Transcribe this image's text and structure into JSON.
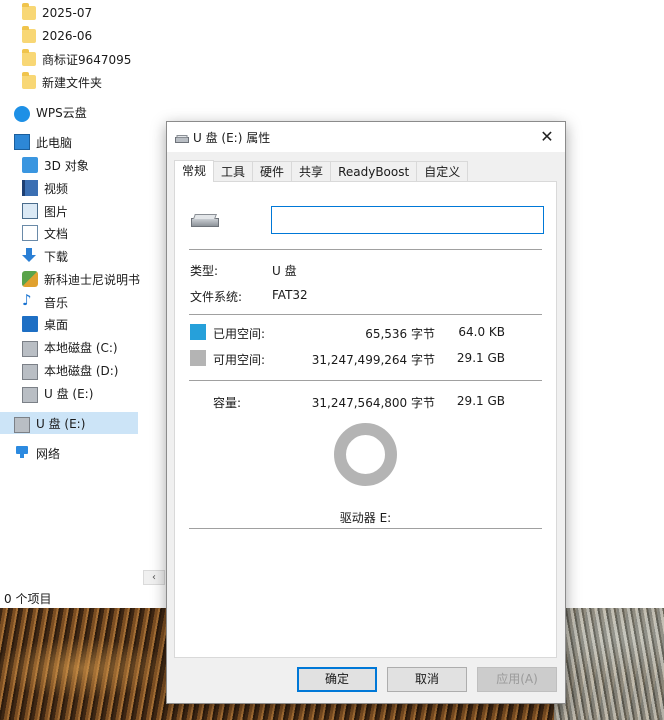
{
  "explorer": {
    "tree": [
      {
        "name": "folder-icon",
        "label": "2025-07"
      },
      {
        "name": "folder-icon",
        "label": "2026-06"
      },
      {
        "name": "folder-icon",
        "label": "商标证9647095"
      },
      {
        "name": "folder-icon",
        "label": "新建文件夹"
      },
      {
        "name": "cloud-icon",
        "label": "WPS云盘"
      },
      {
        "name": "computer-icon",
        "label": "此电脑"
      },
      {
        "name": "3d-objects-icon",
        "label": "3D 对象"
      },
      {
        "name": "video-icon",
        "label": "视频"
      },
      {
        "name": "pictures-icon",
        "label": "图片"
      },
      {
        "name": "documents-icon",
        "label": "文档"
      },
      {
        "name": "download-icon",
        "label": "下载"
      },
      {
        "name": "app-icon",
        "label": "新科迪士尼说明书"
      },
      {
        "name": "music-icon",
        "label": "音乐"
      },
      {
        "name": "desktop-icon",
        "label": "桌面"
      },
      {
        "name": "drive-icon",
        "label": "本地磁盘 (C:)"
      },
      {
        "name": "drive-icon",
        "label": "本地磁盘 (D:)"
      },
      {
        "name": "usb-drive-icon",
        "label": "U 盘 (E:)"
      },
      {
        "name": "usb-drive-icon",
        "label": "U 盘 (E:)"
      },
      {
        "name": "network-icon",
        "label": "网络"
      }
    ],
    "status": "0 个项目"
  },
  "dialog": {
    "title": "U 盘 (E:) 属性",
    "close_glyph": "✕",
    "tabs": [
      "常规",
      "工具",
      "硬件",
      "共享",
      "ReadyBoost",
      "自定义"
    ],
    "active_tab": "常规",
    "volume_label_value": "",
    "type_label": "类型:",
    "type_value": "U 盘",
    "fs_label": "文件系统:",
    "fs_value": "FAT32",
    "used_label": "已用空间:",
    "used_bytes": "65,536 字节",
    "used_size": "64.0 KB",
    "free_label": "可用空间:",
    "free_bytes": "31,247,499,264 字节",
    "free_size": "29.1 GB",
    "capacity_label": "容量:",
    "capacity_bytes": "31,247,564,800 字节",
    "capacity_size": "29.1 GB",
    "drive_label": "驱动器 E:",
    "used_color": "#26a0da",
    "free_color": "#b4b4b4",
    "buttons": {
      "ok": "确定",
      "cancel": "取消",
      "apply": "应用(A)"
    }
  }
}
